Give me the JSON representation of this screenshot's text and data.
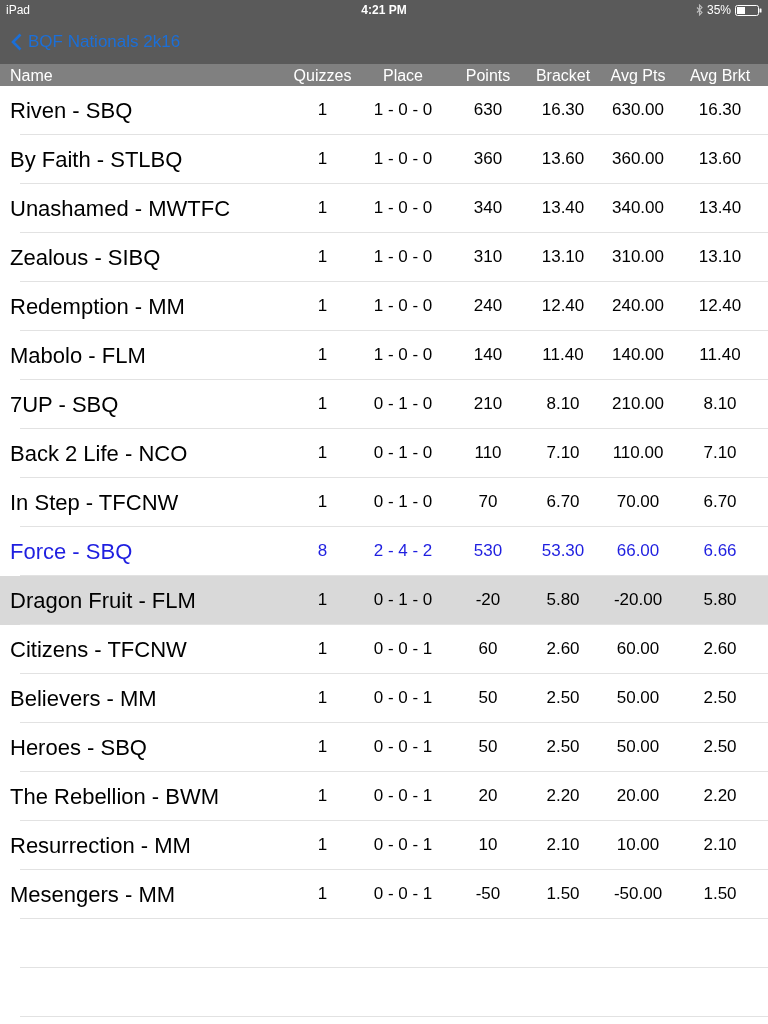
{
  "status_bar": {
    "device": "iPad",
    "time": "4:21 PM",
    "battery": "35%"
  },
  "nav_bar": {
    "back_button": "BQF Nationals 2k16"
  },
  "table": {
    "columns": [
      "Name",
      "Quizzes",
      "Place",
      "Points",
      "Bracket",
      "Avg Pts",
      "Avg Brkt"
    ],
    "rows": [
      {
        "cells": [
          "Riven - SBQ",
          "1",
          "1 - 0 - 0",
          "630",
          "16.30",
          "630.00",
          "16.30"
        ],
        "highlighted": false,
        "selected": false
      },
      {
        "cells": [
          "By Faith - STLBQ",
          "1",
          "1 - 0 - 0",
          "360",
          "13.60",
          "360.00",
          "13.60"
        ],
        "highlighted": false,
        "selected": false
      },
      {
        "cells": [
          "Unashamed - MWTFC",
          "1",
          "1 - 0 - 0",
          "340",
          "13.40",
          "340.00",
          "13.40"
        ],
        "highlighted": false,
        "selected": false
      },
      {
        "cells": [
          "Zealous - SIBQ",
          "1",
          "1 - 0 - 0",
          "310",
          "13.10",
          "310.00",
          "13.10"
        ],
        "highlighted": false,
        "selected": false
      },
      {
        "cells": [
          "Redemption - MM",
          "1",
          "1 - 0 - 0",
          "240",
          "12.40",
          "240.00",
          "12.40"
        ],
        "highlighted": false,
        "selected": false
      },
      {
        "cells": [
          "Mabolo - FLM",
          "1",
          "1 - 0 - 0",
          "140",
          "11.40",
          "140.00",
          "11.40"
        ],
        "highlighted": false,
        "selected": false
      },
      {
        "cells": [
          "7UP - SBQ",
          "1",
          "0 - 1 - 0",
          "210",
          "8.10",
          "210.00",
          "8.10"
        ],
        "highlighted": false,
        "selected": false
      },
      {
        "cells": [
          "Back 2 Life - NCO",
          "1",
          "0 - 1 - 0",
          "110",
          "7.10",
          "110.00",
          "7.10"
        ],
        "highlighted": false,
        "selected": false
      },
      {
        "cells": [
          "In Step - TFCNW",
          "1",
          "0 - 1 - 0",
          "70",
          "6.70",
          "70.00",
          "6.70"
        ],
        "highlighted": false,
        "selected": false
      },
      {
        "cells": [
          "Force - SBQ",
          "8",
          "2 - 4 - 2",
          "530",
          "53.30",
          "66.00",
          "6.66"
        ],
        "highlighted": true,
        "selected": false
      },
      {
        "cells": [
          "Dragon Fruit - FLM",
          "1",
          "0 - 1 - 0",
          "-20",
          "5.80",
          "-20.00",
          "5.80"
        ],
        "highlighted": false,
        "selected": true
      },
      {
        "cells": [
          "Citizens - TFCNW",
          "1",
          "0 - 0 - 1",
          "60",
          "2.60",
          "60.00",
          "2.60"
        ],
        "highlighted": false,
        "selected": false
      },
      {
        "cells": [
          "Believers - MM",
          "1",
          "0 - 0 - 1",
          "50",
          "2.50",
          "50.00",
          "2.50"
        ],
        "highlighted": false,
        "selected": false
      },
      {
        "cells": [
          "Heroes - SBQ",
          "1",
          "0 - 0 - 1",
          "50",
          "2.50",
          "50.00",
          "2.50"
        ],
        "highlighted": false,
        "selected": false
      },
      {
        "cells": [
          "The Rebellion - BWM",
          "1",
          "0 - 0 - 1",
          "20",
          "2.20",
          "20.00",
          "2.20"
        ],
        "highlighted": false,
        "selected": false
      },
      {
        "cells": [
          "Resurrection - MM",
          "1",
          "0 - 0 - 1",
          "10",
          "2.10",
          "10.00",
          "2.10"
        ],
        "highlighted": false,
        "selected": false
      },
      {
        "cells": [
          "Mesengers - MM",
          "1",
          "0 - 0 - 1",
          "-50",
          "1.50",
          "-50.00",
          "1.50"
        ],
        "highlighted": false,
        "selected": false
      }
    ]
  }
}
